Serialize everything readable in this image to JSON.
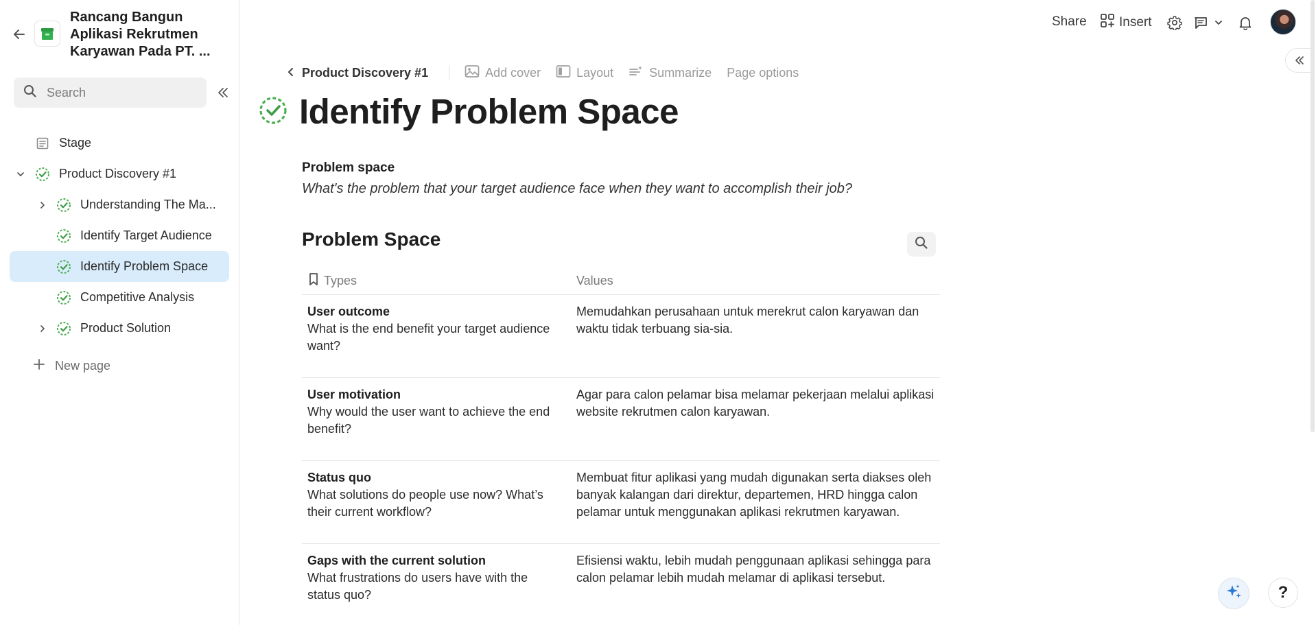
{
  "sidebar": {
    "workspace_title": "Rancang Bangun Aplikasi Rekrutmen Karyawan Pada PT. ...",
    "search_placeholder": "Search",
    "items": [
      {
        "label": "Stage",
        "level": 0,
        "icon": "page-icon",
        "expandable": false,
        "expanded": false,
        "active": false
      },
      {
        "label": "Product Discovery #1",
        "level": 0,
        "icon": "progress-check-icon",
        "expandable": true,
        "expanded": true,
        "active": false
      },
      {
        "label": "Understanding The Ma...",
        "level": 1,
        "icon": "progress-check-icon",
        "expandable": true,
        "expanded": false,
        "active": false
      },
      {
        "label": "Identify Target Audience",
        "level": 1,
        "icon": "progress-check-icon",
        "expandable": false,
        "expanded": false,
        "active": false
      },
      {
        "label": "Identify Problem Space",
        "level": 1,
        "icon": "progress-check-icon",
        "expandable": false,
        "expanded": false,
        "active": true
      },
      {
        "label": "Competitive Analysis",
        "level": 1,
        "icon": "progress-check-icon",
        "expandable": false,
        "expanded": false,
        "active": false
      },
      {
        "label": "Product Solution",
        "level": 1,
        "icon": "progress-check-icon",
        "expandable": true,
        "expanded": false,
        "active": false
      }
    ],
    "new_page_label": "New page"
  },
  "topbar": {
    "share_label": "Share",
    "insert_label": "Insert"
  },
  "toolbar": {
    "breadcrumb": "Product Discovery #1",
    "add_cover": "Add cover",
    "layout": "Layout",
    "summarize": "Summarize",
    "page_options": "Page options"
  },
  "page": {
    "title": "Identify Problem Space",
    "section_label": "Problem space",
    "section_desc": "What's the problem that your target audience face when they want to accomplish their job?",
    "db_title": "Problem Space"
  },
  "table": {
    "headers": {
      "types": "Types",
      "values": "Values"
    },
    "rows": [
      {
        "label": "User outcome",
        "question": "What is the end benefit your target audience want?",
        "value": "Memudahkan perusahaan untuk merekrut calon karyawan dan waktu tidak terbuang sia-sia."
      },
      {
        "label": "User motivation",
        "question": "Why would the user want to achieve the end benefit?",
        "value": "Agar para calon pelamar bisa melamar pekerjaan melalui aplikasi website rekrutmen calon karyawan."
      },
      {
        "label": "Status quo",
        "question": "What solutions do people use now? What’s their current workflow?",
        "value": "Membuat fitur aplikasi yang mudah digunakan serta diakses oleh banyak kalangan dari direktur, departemen, HRD hingga calon pelamar untuk menggunakan aplikasi rekrutmen karyawan."
      },
      {
        "label": "Gaps with the current solution",
        "question": "What frustrations do users have with the status quo?",
        "value": "Efisiensi waktu, lebih mudah penggunaan aplikasi sehingga para calon pelamar lebih mudah melamar di aplikasi tersebut."
      }
    ]
  },
  "fab": {
    "help_label": "?"
  },
  "colors": {
    "accent_green": "#4caf50",
    "active_bg": "#d9ecfb",
    "ai_blue": "#2b7bd6"
  }
}
